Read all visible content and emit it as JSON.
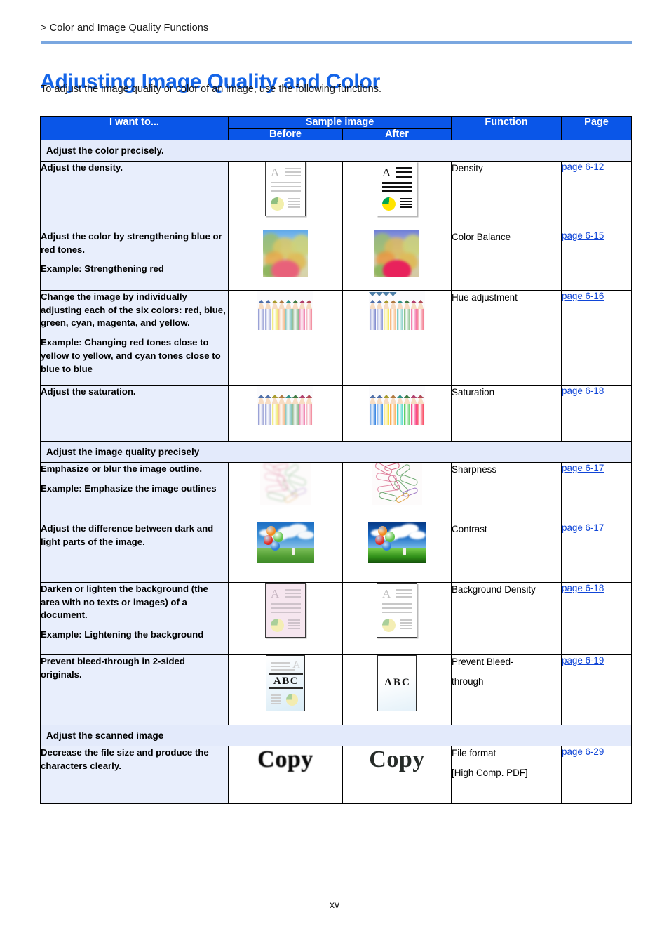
{
  "breadcrumb": "> Color and Image Quality Functions",
  "title": "Adjusting Image Quality and Color",
  "subtitle": "To adjust the image quality or color of an image, use the following functions.",
  "footer": {
    "page_number": "xv"
  },
  "colors": {
    "header_blue": "#0a56e8",
    "title_blue": "#1565e8",
    "rule_blue": "#7aa7e0",
    "section_row": "#e3eafb",
    "want_cell": "#e8eefc",
    "link_blue": "#1046d8"
  },
  "table": {
    "headers": {
      "want_to": "I want to...",
      "sample_image": "Sample image",
      "before": "Before",
      "after": "After",
      "function": "Function",
      "page": "Page"
    },
    "sections": [
      {
        "label": "Adjust the color precisely.",
        "rows": [
          {
            "want_lines": [
              "Adjust the density."
            ],
            "function": "Density",
            "function_line2": "",
            "page": "page 6-12",
            "sample_before": "document-light-icon",
            "sample_after": "document-dark-icon"
          },
          {
            "want_lines": [
              "Adjust the color by strengthening blue or red tones.",
              "Example: Strengthening red"
            ],
            "function": "Color Balance",
            "function_line2": "",
            "page": "page 6-15",
            "sample_before": "autumn-foliage-photo",
            "sample_after": "autumn-foliage-photo-red-strengthened"
          },
          {
            "want_lines": [
              "Change the image by individually adjusting each of the six colors: red, blue, green, cyan, magenta, and yellow.",
              "Example: Changing red tones close to yellow to yellow, and cyan tones close to blue to blue"
            ],
            "function": "Hue adjustment",
            "function_line2": "",
            "page": "page 6-16",
            "sample_before": "colored-pencils-photo",
            "sample_after": "colored-pencils-photo-hue-shifted"
          },
          {
            "want_lines": [
              "Adjust the saturation."
            ],
            "function": "Saturation",
            "function_line2": "",
            "page": "page 6-18",
            "sample_before": "colored-pencils-photo-desaturated",
            "sample_after": "colored-pencils-photo-saturated"
          }
        ]
      },
      {
        "label": "Adjust the image quality precisely",
        "rows": [
          {
            "want_lines": [
              "Emphasize or blur the image outline.",
              "Example: Emphasize the image outlines"
            ],
            "function": "Sharpness",
            "function_line2": "",
            "page": "page 6-17",
            "sample_before": "paperclips-photo-blurred",
            "sample_after": "paperclips-photo-sharpened"
          },
          {
            "want_lines": [
              "Adjust the difference between dark and light parts of the image."
            ],
            "function": "Contrast",
            "function_line2": "",
            "page": "page 6-17",
            "sample_before": "balloons-photo-low-contrast",
            "sample_after": "balloons-photo-high-contrast"
          },
          {
            "want_lines": [
              "Darken or lighten the background (the area with no texts or images) of a document.",
              "Example: Lightening the background"
            ],
            "function": "Background Density",
            "function_line2": "",
            "page": "page 6-18",
            "sample_before": "document-pink-background-icon",
            "sample_after": "document-white-background-icon"
          },
          {
            "want_lines": [
              "Prevent bleed-through in 2-sided originals."
            ],
            "function": "Prevent Bleed-",
            "function_line2": "through",
            "page": "page 6-19",
            "sample_before": "document-bleed-through-icon",
            "sample_after": "document-clean-abc-icon"
          }
        ]
      },
      {
        "label": "Adjust the scanned image",
        "rows": [
          {
            "want_lines": [
              "Decrease the file size and produce the characters clearly."
            ],
            "function": "File format",
            "function_line2": "[High Comp. PDF]",
            "page": "page 6-29",
            "sample_before": "copy-word-blurred",
            "sample_after": "copy-word-clear",
            "sample_before_text": "Copy",
            "sample_after_text": "Copy"
          }
        ]
      }
    ]
  }
}
